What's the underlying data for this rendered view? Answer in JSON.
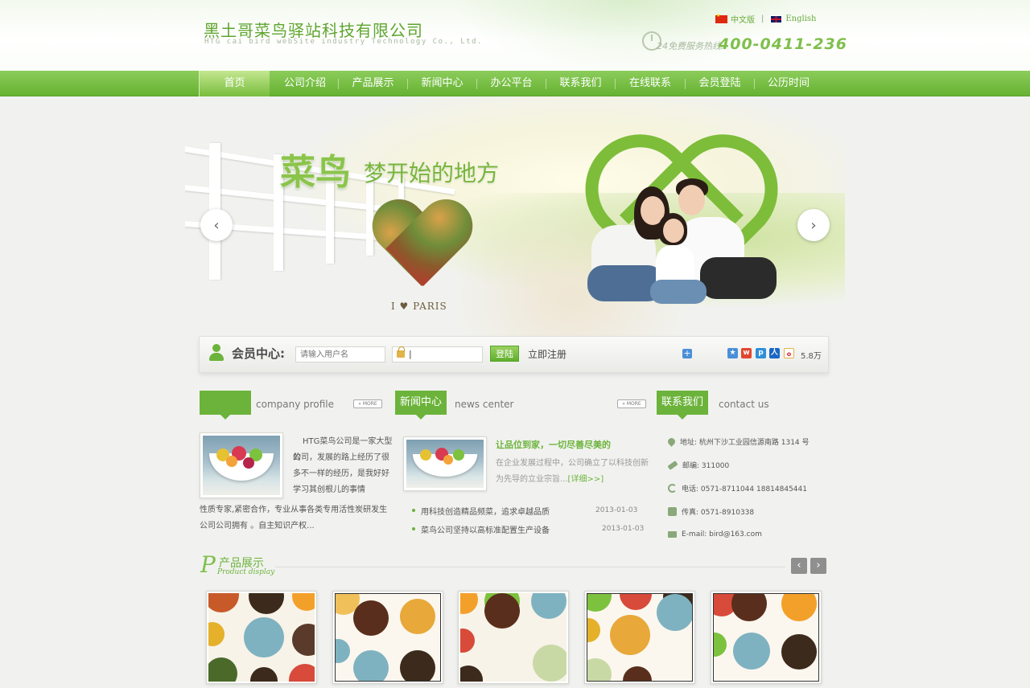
{
  "header": {
    "company_cn": "黑土哥菜鸟驿站科技有限公司",
    "company_en": "HTG cai bird webSite industry Technology Co., Ltd.",
    "lang_cn": "中文版",
    "lang_sep": "|",
    "lang_en": "English",
    "hotline_label": "24免费服务热线:",
    "hotline_number": "400-0411-236"
  },
  "nav": {
    "items": [
      "首页",
      "公司介绍",
      "产品展示",
      "新闻中心",
      "办公平台",
      "联系我们",
      "在线联系",
      "会员登陆",
      "公历时间"
    ]
  },
  "banner": {
    "title_main": "菜鸟",
    "title_sub": "梦开始的地方",
    "paris_text": "I ♥ PARIS",
    "prev_icon": "‹",
    "next_icon": "›"
  },
  "member": {
    "label": "会员中心:",
    "username_placeholder": "请输入用户名",
    "password_value": "|",
    "login_label": "登陆",
    "register_label": "立即注册",
    "share_count": "5.8万"
  },
  "company": {
    "tab": "",
    "en": "company profile",
    "more": "» MORE",
    "desc_lines": [
      "HTG菜鸟公司是一家大型的",
      "公司，发展的路上经历了很",
      "多不一样的经历，是我好好",
      "学习其创根儿的事情"
    ],
    "desc_bottom": [
      "性质专家,紧密合作，专业从事各类专用活性炭研发生",
      "公司公司拥有 。自主知识产权..."
    ]
  },
  "news": {
    "tab": "新闻中心",
    "en": "news center",
    "more": "» MORE",
    "headline": "让品位到家，一切尽善尽美的",
    "summary_1": "在企业发展过程中，公司确立了以科技创新",
    "summary_2": "为先导的立业宗旨...",
    "detail": "[详细>>]",
    "items": [
      {
        "title": "用科技创造精品频菜，追求卓越品质",
        "date": "2013-01-03"
      },
      {
        "title": "菜鸟公司坚持以高标准配置生产设备",
        "date": "2013-01-03"
      }
    ]
  },
  "contact": {
    "tab": "联系我们",
    "en": "contact us",
    "address": "地址: 杭州下沙工业园信源南路 1314 号",
    "postcode": "邮编: 311000",
    "phone": "电话: 0571-8711044    18814845441",
    "fax": "传真: 0571-8910338",
    "email": "E-mail: bird@163.com"
  },
  "products": {
    "p_letter": "P",
    "title_cn": "产品展示",
    "title_en": "Product display",
    "prev": "‹",
    "next": "›"
  },
  "colors": {
    "brand_green": "#6cb33b",
    "nav_green": "#7cc046",
    "hotline": "#7fbf4c"
  }
}
